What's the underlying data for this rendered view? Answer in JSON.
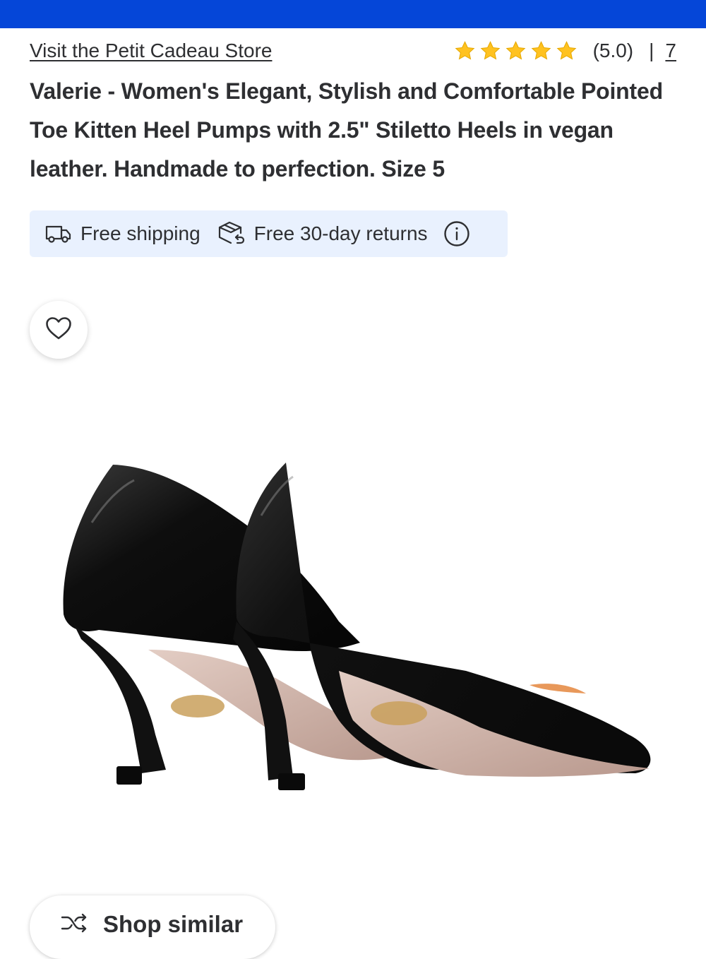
{
  "store": {
    "link_text": "Visit the Petit Cadeau Store"
  },
  "rating": {
    "stars": 5,
    "value_text": "(5.0)",
    "separator": "|",
    "review_count": "7"
  },
  "product": {
    "title": "Valerie - Women's Elegant, Stylish and Comfortable Pointed Toe Kitten Heel Pumps with 2.5\" Stiletto Heels in vegan leather. Handmade to perfection. Size 5"
  },
  "benefits": {
    "shipping": "Free shipping",
    "returns": "Free 30-day returns"
  },
  "actions": {
    "shop_similar": "Shop similar"
  },
  "icons": {
    "favorite": "heart-icon",
    "shipping": "truck-icon",
    "returns": "return-box-icon",
    "info": "info-icon",
    "shop_similar": "shuffle-icon",
    "star": "star-icon"
  },
  "colors": {
    "brand_blue": "#0546d8",
    "star": "#ffc220",
    "benefit_bg": "#e9f1fe",
    "text": "#2e2f32"
  }
}
